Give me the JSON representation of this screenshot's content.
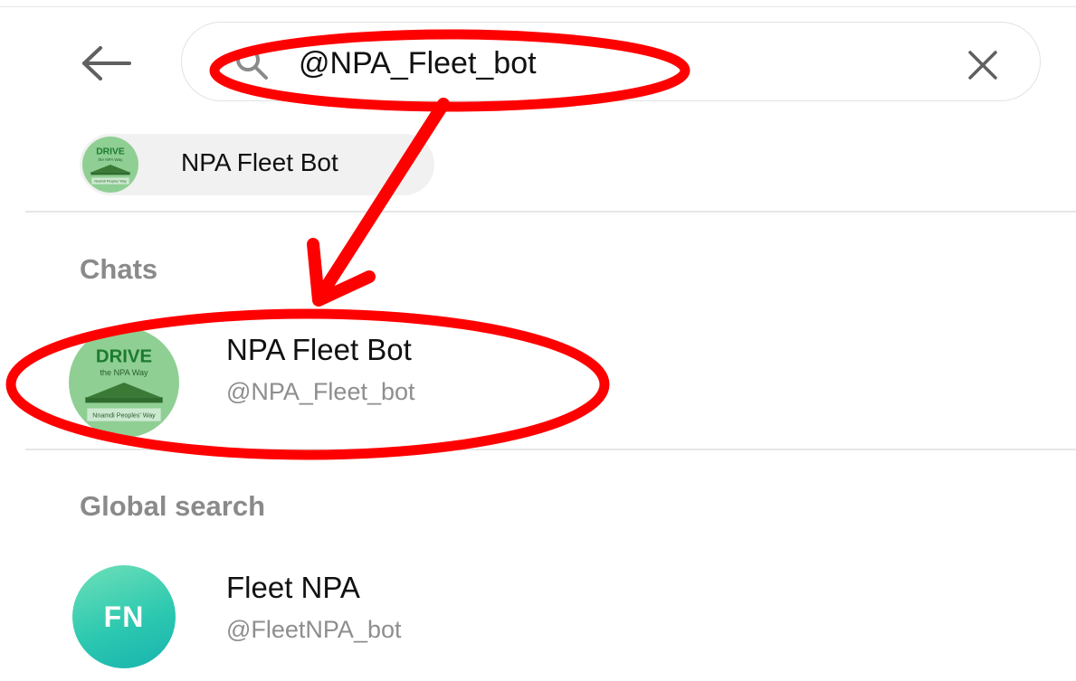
{
  "search": {
    "query": "@NPA_Fleet_bot"
  },
  "recent": {
    "chip_label": "NPA Fleet Bot"
  },
  "avatar_logo": {
    "line1": "DRIVE",
    "line2": "the NPA Way",
    "line3": "Nnamdi Peoples' Way"
  },
  "sections": {
    "chats_title": "Chats",
    "global_title": "Global search"
  },
  "chats": [
    {
      "name": "NPA Fleet Bot",
      "username": "@NPA_Fleet_bot"
    }
  ],
  "global_results": [
    {
      "name": "Fleet NPA",
      "username": "@FleetNPA_bot",
      "initials": "FN"
    }
  ],
  "colors": {
    "annotation_red": "#ff0000",
    "avatar_green": "#8fcf94",
    "fn_avatar_teal": "#2ec9b0",
    "section_gray": "#8a8a8a"
  },
  "icons": {
    "back": "back-arrow-icon",
    "search": "search-icon",
    "clear": "close-icon"
  }
}
